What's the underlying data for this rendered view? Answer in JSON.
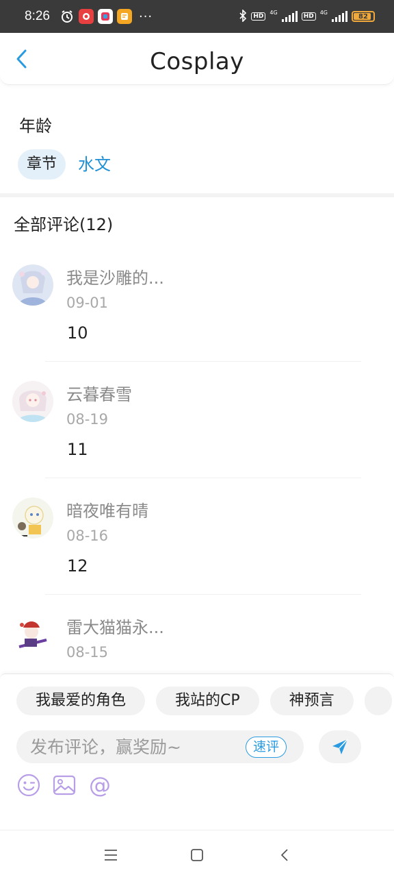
{
  "status_bar": {
    "time": "8:26",
    "net_label_1": "4G",
    "net_label_2": "4G",
    "hd_1": "HD",
    "hd_2": "HD",
    "battery": "82",
    "battery_level": 0.82,
    "dots": "···"
  },
  "header": {
    "title": "Cosplay",
    "back_icon": "chevron-left-icon"
  },
  "info": {
    "label": "年龄",
    "chapter_tag": "章节",
    "category_link": "水文"
  },
  "comments": {
    "title": "全部评论(12)",
    "items": [
      {
        "user": "我是沙雕的...",
        "date": "09-01",
        "text": "10"
      },
      {
        "user": "云暮春雪",
        "date": "08-19",
        "text": "11"
      },
      {
        "user": "暗夜唯有晴",
        "date": "08-16",
        "text": "12"
      },
      {
        "user": "雷大猫猫永...",
        "date": "08-15",
        "text": ""
      }
    ]
  },
  "composer": {
    "chips": [
      "我最爱的角色",
      "我站的CP",
      "神预言"
    ],
    "placeholder": "发布评论，赢奖励~",
    "quick_label": "速评",
    "send_icon": "send-icon",
    "tool_icons": [
      "emoji-icon",
      "image-icon",
      "at-icon"
    ],
    "at_symbol": "@"
  },
  "navbar": {
    "icons": [
      "menu-icon",
      "home-icon",
      "back-icon"
    ]
  },
  "colors": {
    "accent": "#1f8fd6",
    "tag_bg": "#e3f0fa",
    "tool_purple": "#b79ee6",
    "status_bar": "#3a3a3a",
    "battery": "#f2a93b"
  }
}
